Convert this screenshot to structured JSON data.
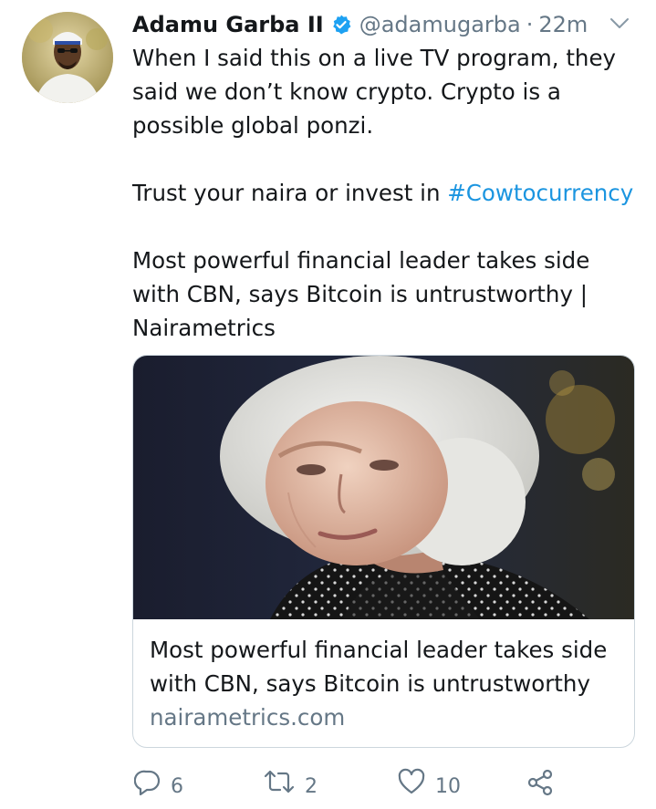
{
  "tweet": {
    "author": {
      "name": "Adamu Garba II",
      "verified": true,
      "handle": "@adamugarba",
      "separator": "·",
      "time": "22m"
    },
    "paragraphs": [
      "When I said this on a live TV program, they said we don’t know crypto. Crypto is a possible global ponzi.",
      "Most powerful financial leader takes side with CBN, says Bitcoin is untrustworthy | Nairametrics"
    ],
    "trust_prefix": "Trust your naira or invest in ",
    "hashtag": "#Cowtocurrency",
    "card": {
      "title": "Most powerful financial leader takes side with CBN, says Bitcoin is untrustworthy",
      "domain": "nairametrics.com"
    },
    "actions": {
      "reply_count": "6",
      "retweet_count": "2",
      "like_count": "10"
    }
  },
  "colors": {
    "text": "#14171a",
    "secondary": "#657786",
    "link": "#1b95e0",
    "border": "#ccd6dd"
  },
  "icons": [
    "verified-badge-icon",
    "chevron-down-icon",
    "reply-icon",
    "retweet-icon",
    "like-icon",
    "share-icon"
  ]
}
